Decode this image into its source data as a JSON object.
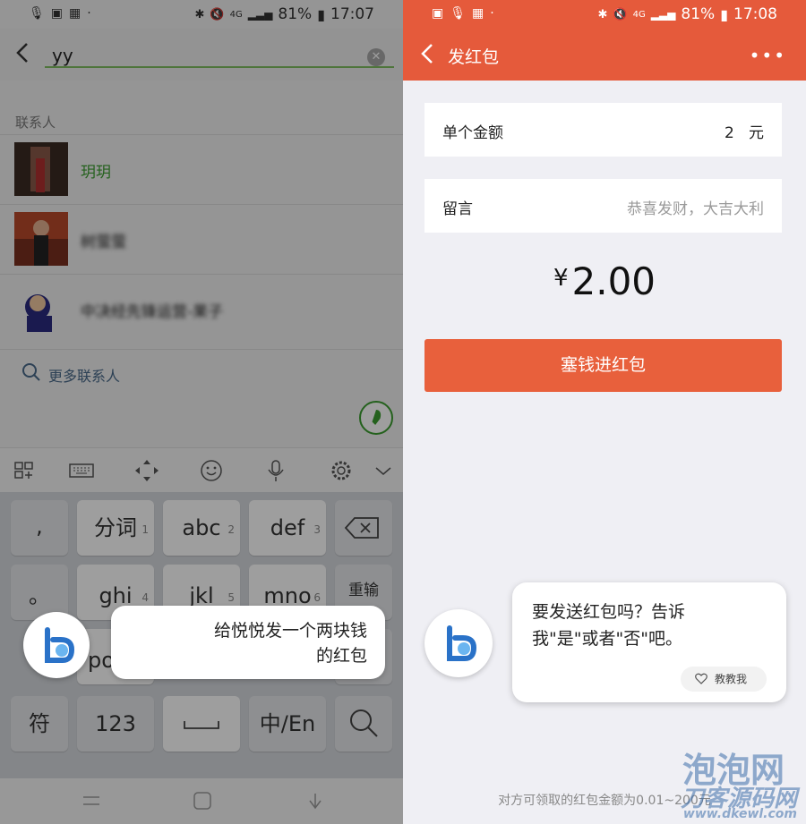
{
  "left": {
    "status": {
      "battery": "81%",
      "time": "17:07",
      "network": "4G"
    },
    "search": {
      "query": "yy"
    },
    "section_label": "联系人",
    "contacts": [
      {
        "name": "玥玥"
      },
      {
        "name": "树萤萤"
      },
      {
        "name": "中决经先锋运营-果子"
      }
    ],
    "more_contacts": "更多联系人",
    "keyboard": {
      "row1": [
        ",",
        "分词",
        "abc",
        "def"
      ],
      "row1_nums": [
        "",
        "1",
        "2",
        "3"
      ],
      "row2": [
        "。",
        "ghi",
        "jkl",
        "mno",
        "重输"
      ],
      "row2_nums": [
        "",
        "4",
        "5",
        "6",
        ""
      ],
      "row3": [
        "po"
      ],
      "row4": [
        "符",
        "123",
        "",
        "中/En"
      ]
    },
    "bixby_bubble": {
      "line1": "给悦悦发一个两块钱",
      "line2": "的红包"
    }
  },
  "right": {
    "status": {
      "battery": "81%",
      "time": "17:08",
      "network": "4G"
    },
    "title": "发红包",
    "amount_row": {
      "label": "单个金额",
      "value": "2",
      "unit": "元"
    },
    "message_row": {
      "label": "留言",
      "placeholder": "恭喜发财，大吉大利"
    },
    "total": {
      "currency": "¥",
      "value": "2.00"
    },
    "send_button": "塞钱进红包",
    "bixby_bubble": {
      "line1": "要发送红包吗？告诉",
      "line2": "我\"是\"或者\"否\"吧。"
    },
    "teach_button": "教教我",
    "footnote": "对方可领取的红包金额为0.01~200元",
    "watermark": {
      "w1": "泡泡网",
      "w2": "刀客源码网",
      "w3": "www.dkewl.com"
    }
  },
  "colors": {
    "header": "#e55a3b",
    "button": "#e8603c",
    "highlight": "#3b9d2f"
  }
}
